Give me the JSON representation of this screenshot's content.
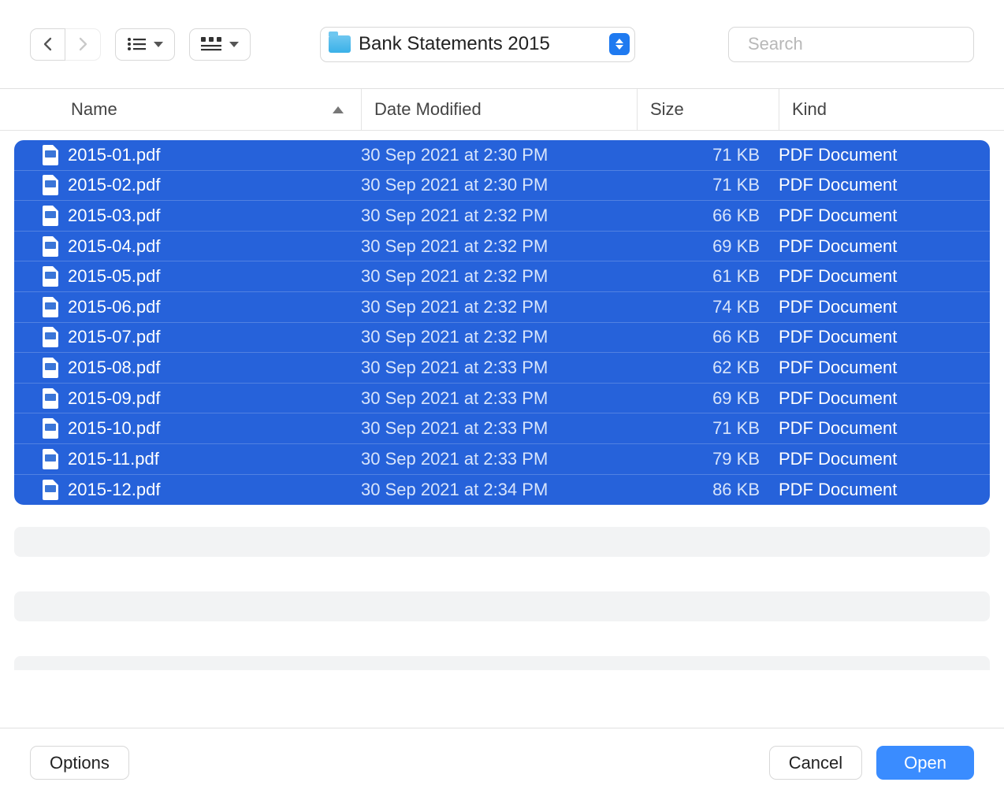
{
  "toolbar": {
    "path_label": "Bank Statements 2015"
  },
  "search": {
    "placeholder": "Search"
  },
  "columns": {
    "name": "Name",
    "date": "Date Modified",
    "size": "Size",
    "kind": "Kind"
  },
  "files": [
    {
      "name": "2015-01.pdf",
      "date": "30 Sep 2021 at 2:30 PM",
      "size": "71 KB",
      "kind": "PDF Document"
    },
    {
      "name": "2015-02.pdf",
      "date": "30 Sep 2021 at 2:30 PM",
      "size": "71 KB",
      "kind": "PDF Document"
    },
    {
      "name": "2015-03.pdf",
      "date": "30 Sep 2021 at 2:32 PM",
      "size": "66 KB",
      "kind": "PDF Document"
    },
    {
      "name": "2015-04.pdf",
      "date": "30 Sep 2021 at 2:32 PM",
      "size": "69 KB",
      "kind": "PDF Document"
    },
    {
      "name": "2015-05.pdf",
      "date": "30 Sep 2021 at 2:32 PM",
      "size": "61 KB",
      "kind": "PDF Document"
    },
    {
      "name": "2015-06.pdf",
      "date": "30 Sep 2021 at 2:32 PM",
      "size": "74 KB",
      "kind": "PDF Document"
    },
    {
      "name": "2015-07.pdf",
      "date": "30 Sep 2021 at 2:32 PM",
      "size": "66 KB",
      "kind": "PDF Document"
    },
    {
      "name": "2015-08.pdf",
      "date": "30 Sep 2021 at 2:33 PM",
      "size": "62 KB",
      "kind": "PDF Document"
    },
    {
      "name": "2015-09.pdf",
      "date": "30 Sep 2021 at 2:33 PM",
      "size": "69 KB",
      "kind": "PDF Document"
    },
    {
      "name": "2015-10.pdf",
      "date": "30 Sep 2021 at 2:33 PM",
      "size": "71 KB",
      "kind": "PDF Document"
    },
    {
      "name": "2015-11.pdf",
      "date": "30 Sep 2021 at 2:33 PM",
      "size": "79 KB",
      "kind": "PDF Document"
    },
    {
      "name": "2015-12.pdf",
      "date": "30 Sep 2021 at 2:34 PM",
      "size": "86 KB",
      "kind": "PDF Document"
    }
  ],
  "footer": {
    "options": "Options",
    "cancel": "Cancel",
    "open": "Open"
  }
}
